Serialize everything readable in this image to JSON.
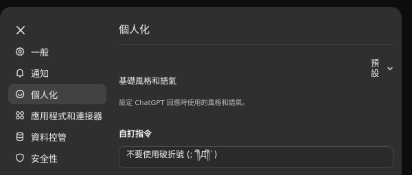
{
  "nav": {
    "items": [
      {
        "label": "一般",
        "icon": "gear-icon"
      },
      {
        "label": "通知",
        "icon": "bell-icon"
      },
      {
        "label": "個人化",
        "icon": "personalization-icon",
        "active": true
      },
      {
        "label": "應用程式和連接器",
        "icon": "apps-icon"
      },
      {
        "label": "資料控管",
        "icon": "database-icon"
      },
      {
        "label": "安全性",
        "icon": "shield-icon"
      }
    ]
  },
  "main": {
    "title": "個人化",
    "style": {
      "label": "基礎風格和語氣",
      "value": "預設",
      "description": "設定 ChatGPT 回應時使用的風格和語氣。"
    },
    "custom": {
      "label": "自訂指令",
      "value": "不要使用破折號 (;´༎ຶД༎ຶ`)"
    }
  }
}
